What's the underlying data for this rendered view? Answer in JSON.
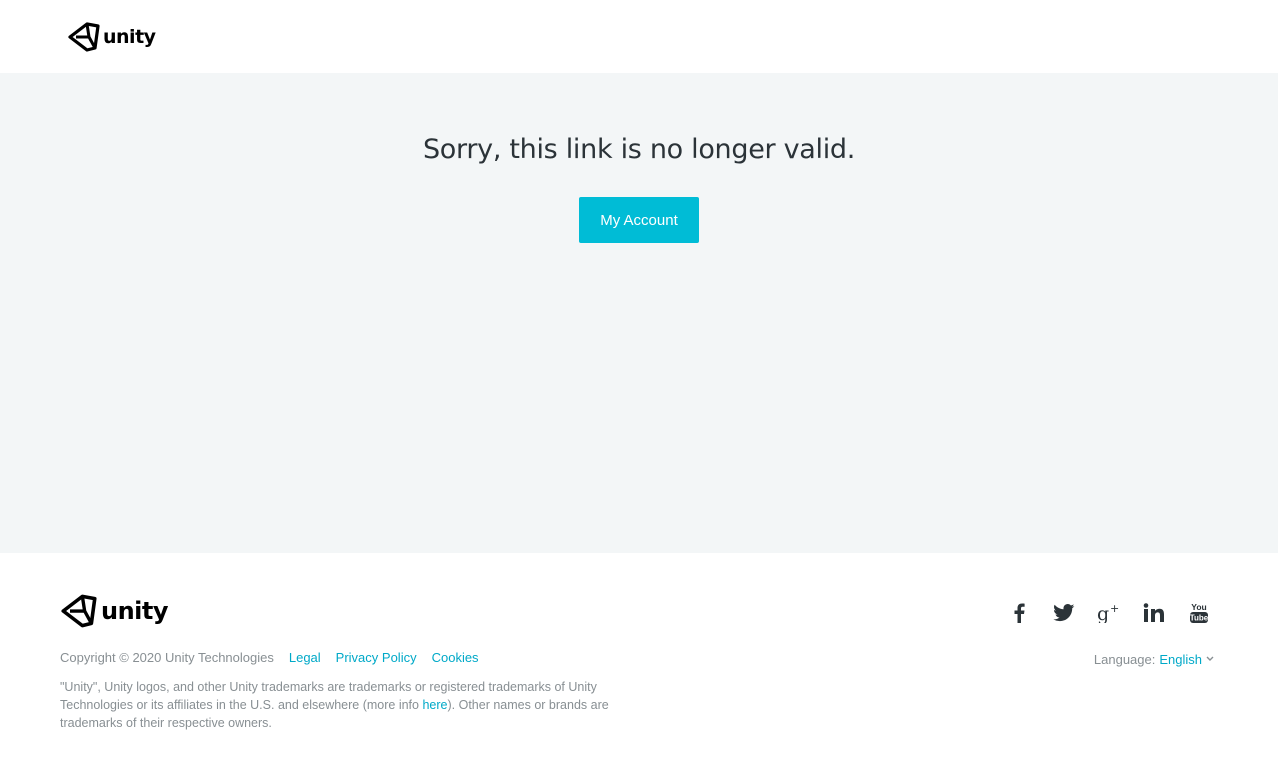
{
  "header": {
    "logo_text": "unity"
  },
  "main": {
    "message": "Sorry, this link is no longer valid.",
    "button_label": "My Account"
  },
  "footer": {
    "logo_text": "unity",
    "copyright": "Copyright © 2020 Unity Technologies",
    "links": {
      "legal": "Legal",
      "privacy": "Privacy Policy",
      "cookies": "Cookies"
    },
    "trademark": {
      "before": "\"Unity\", Unity logos, and other Unity trademarks are trademarks or registered trademarks of Unity Technologies or its affiliates in the U.S. and elsewhere (more info ",
      "link": "here",
      "after": "). Other names or brands are trademarks of their respective owners."
    },
    "language": {
      "label": "Language:",
      "value": "English"
    },
    "social": [
      "facebook-icon",
      "twitter-icon",
      "google-plus-icon",
      "linkedin-icon",
      "youtube-icon"
    ],
    "youtube_icon_text": {
      "top": "You",
      "bottom": "Tube"
    }
  },
  "colors": {
    "accent": "#00bcd6",
    "link": "#00a9c8",
    "main_bg": "#f3f6f7",
    "text": "#2b3338",
    "muted": "#888f93"
  }
}
